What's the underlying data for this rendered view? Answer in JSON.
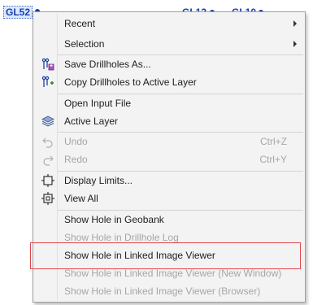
{
  "background": {
    "hole_labels": [
      "GL52",
      "GL13",
      "GL10"
    ]
  },
  "menu": {
    "items": [
      {
        "label": "Recent",
        "submenu": true,
        "disabled": false,
        "icon": ""
      },
      {
        "label": "Selection",
        "submenu": true,
        "disabled": false,
        "icon": ""
      },
      {
        "label": "Save Drillholes As...",
        "disabled": false,
        "icon": "save-drillholes-icon"
      },
      {
        "label": "Copy Drillholes to Active Layer",
        "disabled": false,
        "icon": "copy-drillholes-icon"
      },
      {
        "label": "Open Input File",
        "disabled": false,
        "icon": ""
      },
      {
        "label": "Active Layer",
        "disabled": false,
        "icon": "layers-icon"
      },
      {
        "label": "Undo",
        "shortcut": "Ctrl+Z",
        "disabled": true,
        "icon": "undo-icon"
      },
      {
        "label": "Redo",
        "shortcut": "Ctrl+Y",
        "disabled": true,
        "icon": "redo-icon"
      },
      {
        "label": "Display Limits...",
        "disabled": false,
        "icon": "display-limits-icon"
      },
      {
        "label": "View All",
        "disabled": false,
        "icon": "view-all-icon"
      },
      {
        "label": "Show Hole in Geobank",
        "disabled": false,
        "icon": ""
      },
      {
        "label": "Show Hole in Drillhole Log",
        "disabled": true,
        "icon": ""
      },
      {
        "label": "Show Hole in Linked Image Viewer",
        "disabled": false,
        "icon": "",
        "highlighted": true
      },
      {
        "label": "Show Hole in Linked Image Viewer (New Window)",
        "disabled": true,
        "icon": ""
      },
      {
        "label": "Show Hole in Linked Image Viewer (Browser)",
        "disabled": true,
        "icon": ""
      }
    ]
  },
  "colors": {
    "highlight_border": "#e0474c",
    "label_blue": "#1a3fa8",
    "disabled_text": "#a6a6a6"
  }
}
